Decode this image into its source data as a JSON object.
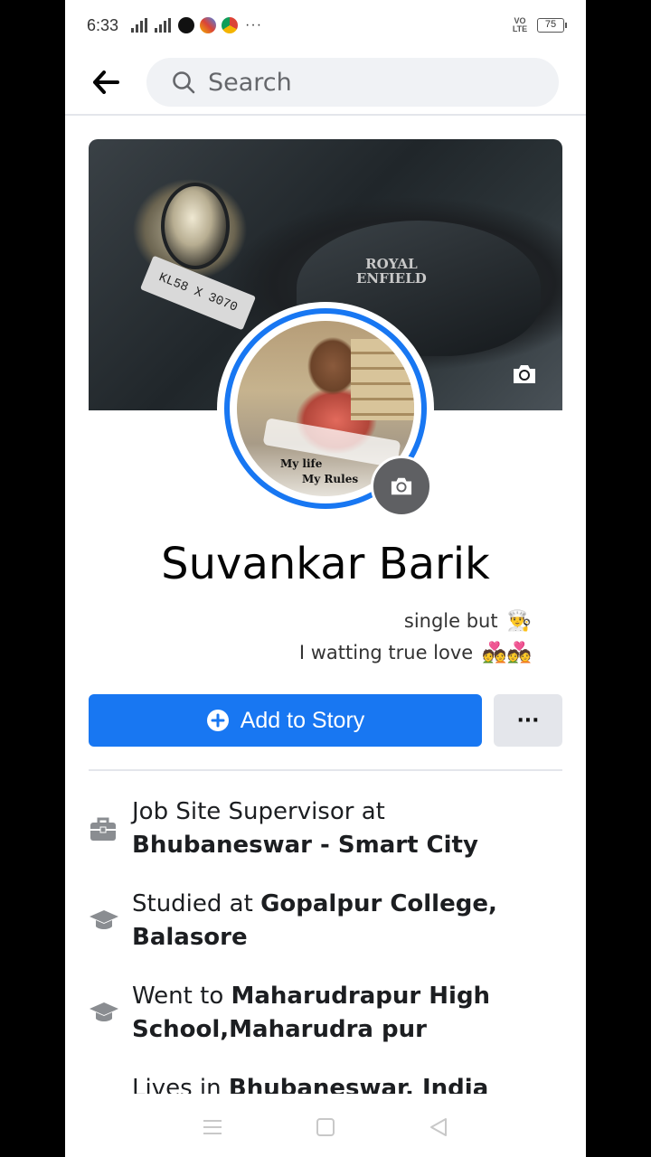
{
  "status_bar": {
    "time": "6:33",
    "network": "4G",
    "dots": "···",
    "volte": "VO LTE",
    "battery": "75"
  },
  "search": {
    "placeholder": "Search"
  },
  "cover": {
    "brand_line1": "ROYAL",
    "brand_line2": "ENFIELD",
    "plate": "KL58 X 3070"
  },
  "avatar": {
    "caption_line1": "My life",
    "caption_line2": "My Rules"
  },
  "profile": {
    "name": "Suvankar Barik",
    "bio_line1": "single but",
    "bio_emoji1": "👨‍🍳",
    "bio_line2": "I watting true love",
    "bio_emoji2": "💑💑"
  },
  "actions": {
    "add_story_label": "Add to Story",
    "more_label": "···"
  },
  "details": [
    {
      "icon": "briefcase-icon",
      "prefix": "Job Site Supervisor at",
      "bold": "Bhubaneswar - Smart City"
    },
    {
      "icon": "graduation-cap-icon",
      "prefix": "Studied at",
      "bold": "Gopalpur College, Balasore"
    },
    {
      "icon": "graduation-cap-icon",
      "prefix": "Went to",
      "bold": "Maharudrapur High School,Maharudra pur"
    },
    {
      "icon": "home-icon",
      "prefix": "Lives in",
      "bold": "Bhubaneswar, India"
    }
  ],
  "colors": {
    "accent": "#1877f2",
    "button_grey": "#e4e6eb",
    "icon_grey": "#8a8d91"
  }
}
